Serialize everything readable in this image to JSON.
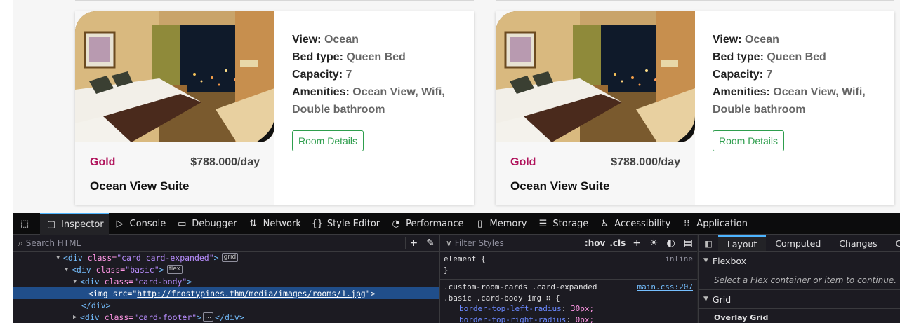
{
  "cards": [
    {
      "view_label": "View:",
      "view": "Ocean",
      "bed_label": "Bed type:",
      "bed": "Queen Bed",
      "capacity_label": "Capacity:",
      "capacity": "7",
      "amenities_label": "Amenities:",
      "amenities": "Ocean View, Wifi, Double bathroom",
      "details_button": "Room Details",
      "tier": "Gold",
      "price": "$788.000/day",
      "name": "Ocean View Suite"
    },
    {
      "view_label": "View:",
      "view": "Ocean",
      "bed_label": "Bed type:",
      "bed": "Queen Bed",
      "capacity_label": "Capacity:",
      "capacity": "7",
      "amenities_label": "Amenities:",
      "amenities": "Ocean View, Wifi, Double bathroom",
      "details_button": "Room Details",
      "tier": "Gold",
      "price": "$788.000/day",
      "name": "Ocean View Suite"
    }
  ],
  "devtools": {
    "tabs": [
      "Inspector",
      "Console",
      "Debugger",
      "Network",
      "Style Editor",
      "Performance",
      "Memory",
      "Storage",
      "Accessibility",
      "Application"
    ],
    "active_tab": "Inspector",
    "search_placeholder": "Search HTML",
    "html_lines": [
      {
        "tag_open": "<div",
        "attr": "class=",
        "val": "\"card card-expanded\"",
        "tag_close": ">",
        "badge": "grid"
      },
      {
        "tag_open": "<div",
        "attr": "class=",
        "val": "\"basic\"",
        "tag_close": ">",
        "badge": "flex"
      },
      {
        "tag_open": "<div",
        "attr": "class=",
        "val": "\"card-body\"",
        "tag_close": ">"
      },
      {
        "tag_open": "<img",
        "attr": "src=",
        "link": "http://frostypines.thm/media/images/rooms/1.jpg",
        "tag_close": "\">"
      },
      {
        "tag_open": "</div>"
      },
      {
        "tag_open": "<div",
        "attr": "class=",
        "val": "\"card-footer\"",
        "tag_close": ">",
        "tail": "</div>",
        "badge": "…"
      }
    ],
    "filter_placeholder": "Filter Styles",
    "hov": ":hov",
    "cls": ".cls",
    "element_rule": "element {",
    "element_close": "}",
    "inline": "inline",
    "selector_1": ".custom-room-cards .card-expanded",
    "selector_2": ".basic .card-body img ∷ {",
    "source": "main.css:207",
    "props": [
      {
        "name": "border-top-left-radius",
        "value": "30px;"
      },
      {
        "name": "border-top-right-radius",
        "value": "0px;"
      }
    ],
    "layout_tabs": [
      "Layout",
      "Computed",
      "Changes",
      "Comp"
    ],
    "flexbox_title": "Flexbox",
    "flexbox_msg": "Select a Flex container or item to continue.",
    "grid_title": "Grid",
    "overlay_grid": "Overlay Grid"
  }
}
